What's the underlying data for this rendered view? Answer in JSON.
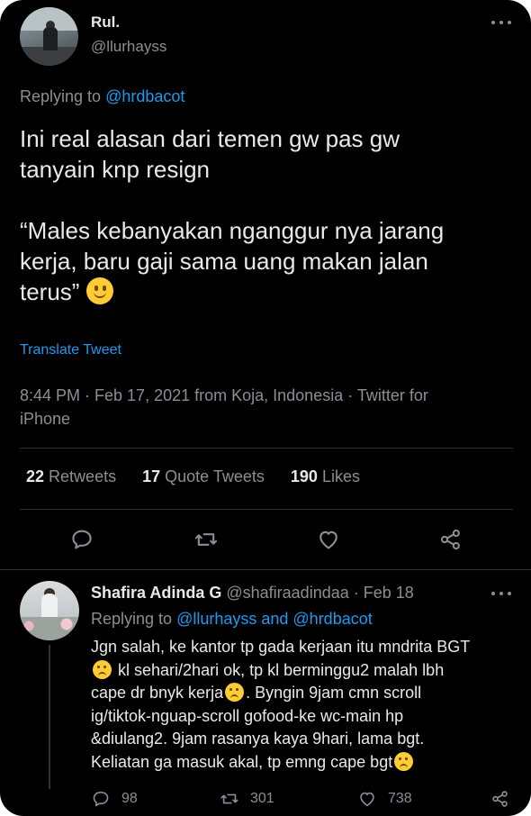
{
  "main_tweet": {
    "name": "Rul.",
    "handle": "@llurhayss",
    "replying_prefix": "Replying to",
    "replying_to": "@hrdbacot",
    "text_line1": "Ini real alasan dari temen gw pas gw",
    "text_line2": "tanyain knp resign",
    "quote_line1": "“Males kebanyakan nganggur nya jarang",
    "quote_line2": "kerja, baru gaji sama uang makan jalan",
    "quote_line3": "terus”",
    "emoji": "slightly-smiling-face",
    "translate": "Translate Tweet",
    "meta_line1": "8:44 PM · Feb 17, 2021 from Koja, Indonesia · Twitter for",
    "meta_line2": "iPhone",
    "stats": {
      "retweets_count": "22",
      "retweets_label": "Retweets",
      "quotes_count": "17",
      "quotes_label": "Quote Tweets",
      "likes_count": "190",
      "likes_label": "Likes"
    },
    "actions": [
      "reply-icon",
      "retweet-icon",
      "like-icon",
      "share-icon"
    ]
  },
  "reply": {
    "name": "Shafira Adinda G",
    "handle": "@shafiraadindaa",
    "date": "· Feb 18",
    "replying_prefix": "Replying to",
    "replying_to": "@llurhayss and @hrdbacot",
    "text_line1": "Jgn salah, ke kantor tp gada kerjaan itu mndrita BGT",
    "text_line2": "kl sehari/2hari ok, tp kl berminggu2 malah lbh",
    "text_line3a": "cape dr bnyk kerja",
    "text_line3b": ". Byngin 9jam cmn scroll",
    "text_line4": "ig/tiktok-nguap-scroll gofood-ke wc-main hp",
    "text_line5": "&diulang2. 9jam rasanya kaya 9hari, lama bgt.",
    "text_line6": "Keliatan ga masuk akal, tp emng cape bgt",
    "reply_count": "98",
    "retweet_count": "301",
    "like_count": "738"
  },
  "colors": {
    "background": "#000000",
    "text": "#e7e9ea",
    "secondary": "#8b8f93",
    "link": "#1d9bf0",
    "divider": "#2f3336"
  }
}
